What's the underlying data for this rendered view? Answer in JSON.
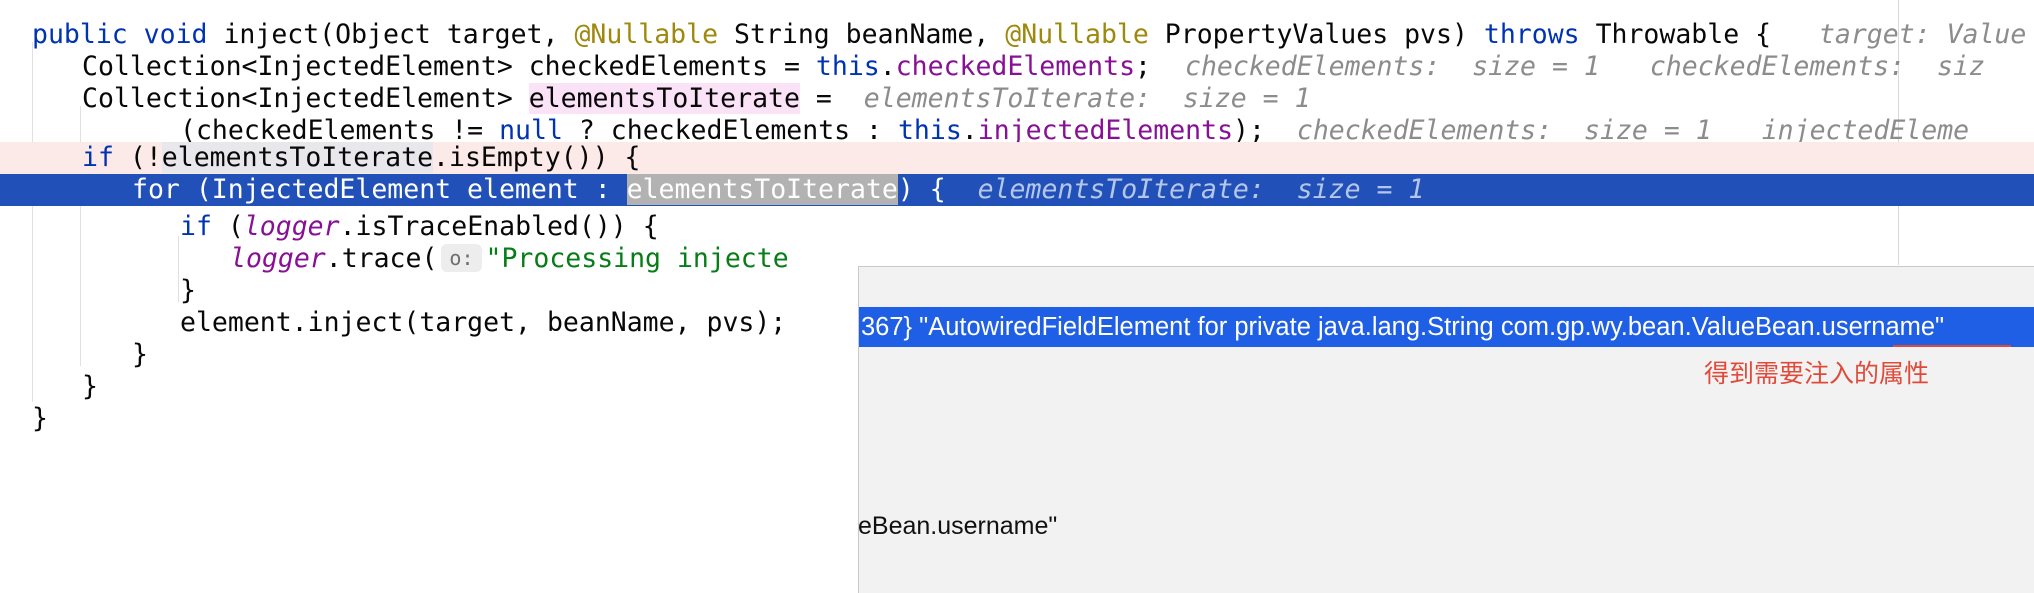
{
  "code": {
    "l1": {
      "a": "public void ",
      "b": "inject(Object target, ",
      "ann1": "@Nullable",
      "c": " String beanName, ",
      "ann2": "@Nullable",
      "d": " PropertyValues pvs) ",
      "kw_throws": "throws",
      "e": " Throwable {   ",
      "hint": "target: Value"
    },
    "l2": {
      "a": "Collection<InjectedElement> checkedElements = ",
      "this_kw": "this",
      "dot": ".",
      "field": "checkedElements",
      "semi": ";",
      "hint1": "checkedElements:  size = 1",
      "hint2": "checkedElements:  siz"
    },
    "l3": {
      "a": "Collection<InjectedElement> ",
      "var": "elementsToIterate",
      "b": " =  ",
      "hint": "elementsToIterate:  size = 1"
    },
    "l4": {
      "a": "(checkedElements != ",
      "null_kw": "null",
      "b": " ? checkedElements : ",
      "this_kw": "this",
      "dot": ".",
      "field": "injectedElements",
      "c": ");  ",
      "hint1": "checkedElements:  size = 1",
      "hint2": "injectedEleme"
    },
    "l5": {
      "if_kw": "if",
      "a": " (!",
      "var": "elementsToIterate",
      "b": ".isEmpty()) {"
    },
    "l6": {
      "for_kw": "for",
      "a": " (InjectedElement element : ",
      "var": "elementsToIterate",
      "b": ") {  ",
      "hint": "elementsToIterate:  size = 1"
    },
    "l7": {
      "if_kw": "if",
      "a": " (",
      "logger": "logger",
      "b": ".isTraceEnabled()) {"
    },
    "l8": {
      "logger": "logger",
      "a": ".trace(",
      "badge": "o:",
      "str": "\"Processing injecte"
    },
    "l9": {
      "a": "}"
    },
    "l10": {
      "a": "element.inject(target, beanName, pvs);"
    },
    "l11": {
      "a": "}"
    },
    "l12": {
      "a": "}"
    },
    "l13": {
      "a": "}"
    }
  },
  "popup": {
    "row_text": "367} \"AutowiredFieldElement for private java.lang.String com.gp.wy.bean.ValueBean.username\"",
    "annotation": "得到需要注入的属性",
    "tail_text": "eBean.username\""
  },
  "colors": {
    "keyword": "#0033b3",
    "annotation": "#9e880d",
    "field": "#871094",
    "string": "#067d17",
    "hint": "#8c8c8c",
    "current_line": "#2151b8",
    "execution_line": "#fbeae7",
    "popup_selection": "#1f5fe6",
    "note": "#e04a3a"
  }
}
